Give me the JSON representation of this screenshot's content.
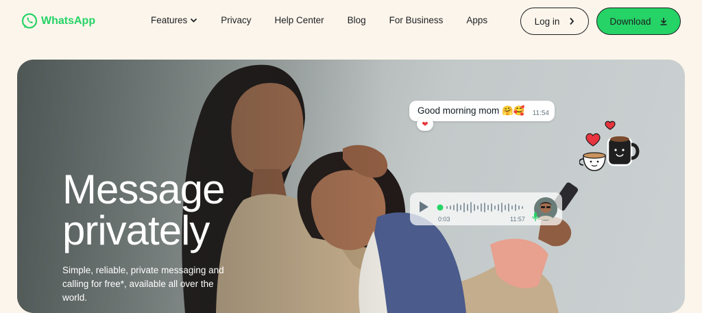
{
  "brand": {
    "name": "WhatsApp",
    "color": "#25d366"
  },
  "nav": {
    "items": [
      {
        "label": "Features",
        "has_dropdown": true
      },
      {
        "label": "Privacy"
      },
      {
        "label": "Help Center"
      },
      {
        "label": "Blog"
      },
      {
        "label": "For Business"
      },
      {
        "label": "Apps"
      }
    ]
  },
  "actions": {
    "login_label": "Log in",
    "download_label": "Download"
  },
  "hero": {
    "title_line1": "Message",
    "title_line2": "privately",
    "subtitle": "Simple, reliable, private messaging and calling for free*, available all over the world."
  },
  "chat": {
    "message": "Good morning mom",
    "message_emoji": "🤗🥰",
    "message_time": "11:54",
    "reaction": "❤",
    "voice_duration": "0:03",
    "voice_time": "11:57"
  },
  "icons": {
    "logo": "whatsapp-logo-icon",
    "dropdown": "chevron-down-icon",
    "login": "chevron-right-icon",
    "download": "download-icon",
    "play": "play-icon",
    "mic": "mic-icon"
  }
}
